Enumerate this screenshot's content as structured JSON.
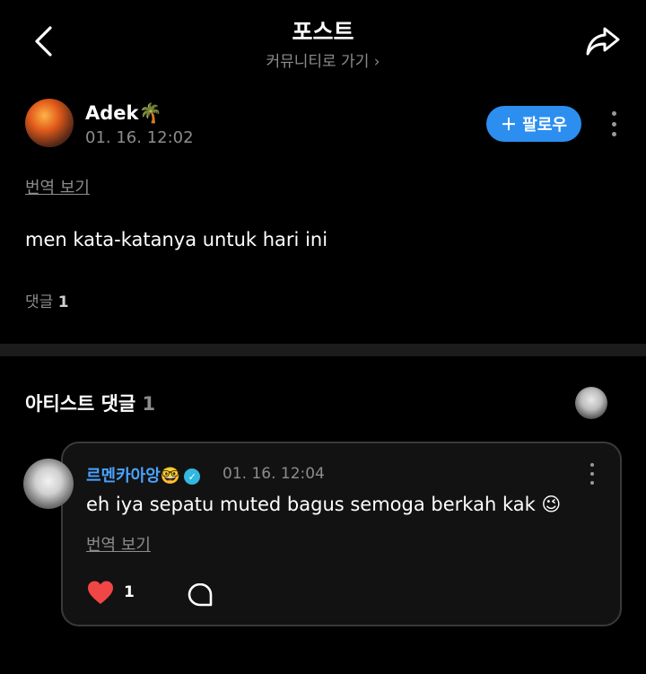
{
  "header": {
    "title": "포스트",
    "subtitle": "커뮤니티로 가기 ›"
  },
  "post": {
    "author_name": "Adek🌴",
    "time": "01. 16. 12:02",
    "follow_label": "＋ 팔로우",
    "translate_label": "번역 보기",
    "body": "men kata-katanya untuk hari ini",
    "comment_label": "댓글",
    "comment_count": "1"
  },
  "artist_section": {
    "title": "아티스트 댓글",
    "count": "1"
  },
  "comment": {
    "author_name": "르멘카아앙🤓",
    "time": "01. 16. 12:04",
    "body": "eh iya sepatu muted bagus semoga berkah kak 😉",
    "translate_label": "번역 보기",
    "like_count": "1"
  },
  "colors": {
    "accent": "#2c8ff0",
    "commenter_name": "#4aa3ff",
    "heart": "#f04646",
    "muted_text": "#8c8c8c"
  },
  "icons": [
    "back-arrow-icon",
    "share-icon",
    "more-vertical-icon",
    "verified-badge-icon",
    "heart-icon",
    "reply-bubble-icon"
  ]
}
